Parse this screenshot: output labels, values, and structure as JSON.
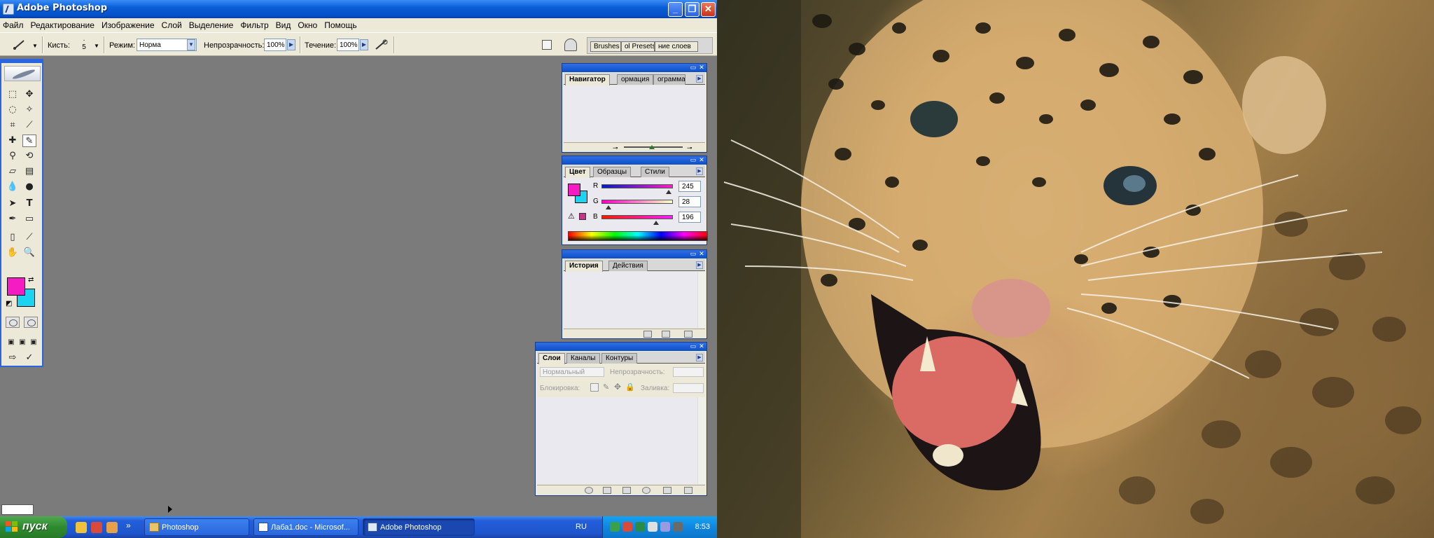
{
  "window": {
    "title": "Adobe Photoshop"
  },
  "menu": [
    "Файл",
    "Редактирование",
    "Изображение",
    "Слой",
    "Выделение",
    "Фильтр",
    "Вид",
    "Окно",
    "Помощь"
  ],
  "options": {
    "brush_label": "Кисть:",
    "brush_size": "5",
    "mode_label": "Режим:",
    "mode_value": "Норма",
    "opacity_label": "Непрозрачность:",
    "opacity_value": "100%",
    "flow_label": "Течение:",
    "flow_value": "100%",
    "well_tabs": [
      "Brushes",
      "ol Presets",
      "ние слоев"
    ]
  },
  "navigator": {
    "tabs": [
      "Навигатор",
      "ормация",
      "ограмма"
    ]
  },
  "color": {
    "tabs": [
      "Цвет",
      "Образцы",
      "Стили"
    ],
    "channels": [
      {
        "name": "R",
        "value": "245"
      },
      {
        "name": "G",
        "value": "28"
      },
      {
        "name": "B",
        "value": "196"
      }
    ],
    "foreground": "#f51cc4",
    "background": "#1cd3f0"
  },
  "history": {
    "tabs": [
      "История",
      "Действия"
    ]
  },
  "layers": {
    "tabs": [
      "Слои",
      "Каналы",
      "Контуры"
    ],
    "blend_mode": "Нормальный",
    "opacity_label": "Непрозрачность:",
    "lock_label": "Блокировка:",
    "fill_label": "Заливка:"
  },
  "taskbar": {
    "start": "пуск",
    "tasks": [
      {
        "label": "Photoshop",
        "icon": "folder-icon"
      },
      {
        "label": "Лаба1.doc - Microsof...",
        "icon": "word-icon"
      },
      {
        "label": "Adobe Photoshop",
        "icon": "photoshop-icon"
      }
    ],
    "quicklaunch_more": "»",
    "language": "RU",
    "time": "8:53"
  }
}
